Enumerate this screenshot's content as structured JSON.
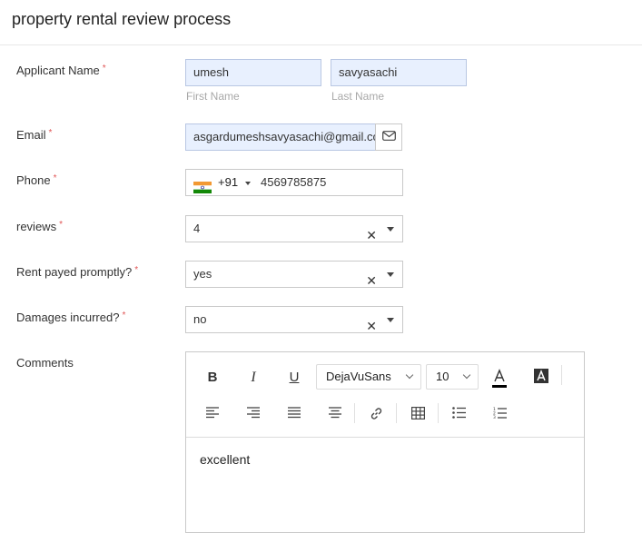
{
  "form": {
    "title": "property rental review process",
    "applicant_name": {
      "label": "Applicant Name",
      "first_name": "umesh",
      "last_name": "savyasachi",
      "first_name_sublabel": "First Name",
      "last_name_sublabel": "Last Name"
    },
    "email": {
      "label": "Email",
      "value": "asgardumeshsavyasachi@gmail.com"
    },
    "phone": {
      "label": "Phone",
      "country_code": "+91",
      "number": "4569785875"
    },
    "reviews": {
      "label": "reviews",
      "value": "4"
    },
    "rent_payed": {
      "label": "Rent payed promptly?",
      "value": "yes"
    },
    "damages": {
      "label": "Damages incurred?",
      "value": "no"
    },
    "comments": {
      "label": "Comments",
      "font_family": "DejaVuSans",
      "font_size": "10",
      "text": "excellent"
    },
    "required_mark": "*"
  }
}
